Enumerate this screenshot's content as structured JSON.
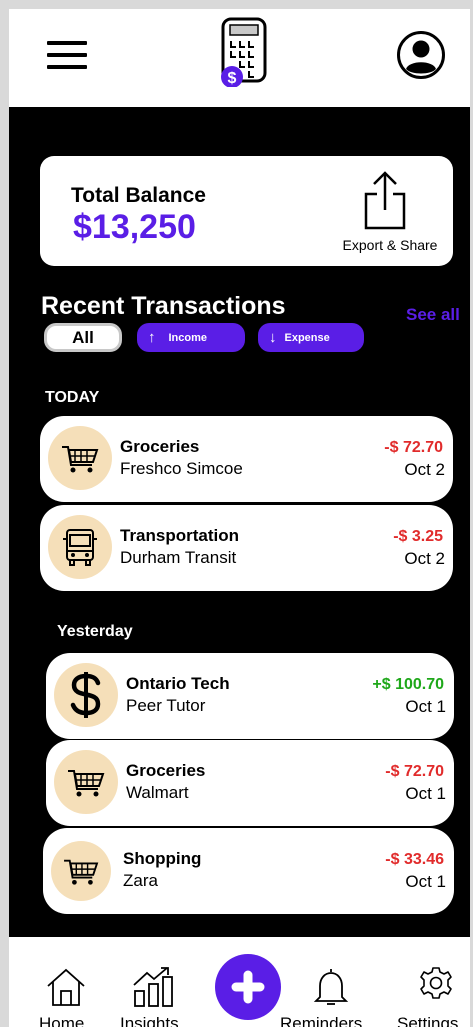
{
  "balance": {
    "label": "Total Balance",
    "value": "$13,250",
    "export_label": "Export & Share"
  },
  "recent": {
    "title": "Recent Transactions",
    "see_all": "See all",
    "filters": {
      "all": "All",
      "income": "Income",
      "expense": "Expense",
      "income_arrow": "↑",
      "expense_arrow": "↓"
    }
  },
  "groups": {
    "today": {
      "label": "TODAY",
      "items": [
        {
          "title": "Groceries",
          "subtitle": "Freshco  Simcoe",
          "amount": "-$ 72.70",
          "date": "Oct 2",
          "icon": "shopping-cart-icon",
          "type": "expense"
        },
        {
          "title": "Transportation",
          "subtitle": "Durham Transit",
          "amount": "-$ 3.25",
          "date": "Oct 2",
          "icon": "bus-icon",
          "type": "expense"
        }
      ]
    },
    "yesterday": {
      "label": "Yesterday",
      "items": [
        {
          "title": "Ontario Tech",
          "subtitle": "Peer Tutor",
          "amount": "+$ 100.70",
          "date": "Oct 1",
          "icon": "dollar-icon",
          "type": "income"
        },
        {
          "title": "Groceries",
          "subtitle": "Walmart",
          "amount": "-$ 72.70",
          "date": "Oct 1",
          "icon": "shopping-cart-icon",
          "type": "expense"
        },
        {
          "title": "Shopping",
          "subtitle": "Zara",
          "amount": "-$ 33.46",
          "date": "Oct 1",
          "icon": "shopping-cart-icon",
          "type": "expense"
        }
      ]
    }
  },
  "logo": {
    "badge": "$"
  },
  "nav": {
    "home": "Home",
    "insights": "Insights",
    "reminders": "Reminders",
    "settings": "Settings"
  },
  "colors": {
    "accent": "#5a1ee6",
    "negative": "#e12b2b",
    "positive": "#1fa81a",
    "icon_bg": "#f5dfb9"
  }
}
